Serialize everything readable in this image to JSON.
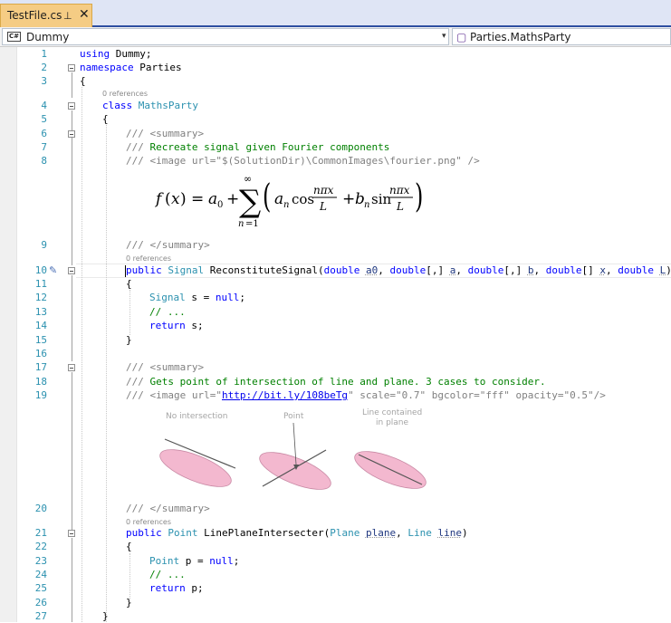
{
  "tab": {
    "title": "TestFile.cs",
    "pin": "⊥",
    "close": "✕"
  },
  "navbar": {
    "left_icon": "C#",
    "left_label": "Dummy",
    "left_arrow": "▾",
    "right_icon": "▢",
    "right_label": "Parties.MathsParty"
  },
  "code": {
    "ln1": "1",
    "ln2": "2",
    "ln3": "3",
    "ln4": "4",
    "ln5": "5",
    "ln6": "6",
    "ln7": "7",
    "ln8": "8",
    "ln9": "9",
    "ln10": "10",
    "ln11": "11",
    "ln12": "12",
    "ln13": "13",
    "ln14": "14",
    "ln15": "15",
    "ln16": "16",
    "ln17": "17",
    "ln18": "18",
    "ln19": "19",
    "ln20": "20",
    "ln21": "21",
    "ln22": "22",
    "ln23": "23",
    "ln24": "24",
    "ln25": "25",
    "ln26": "26",
    "ln27": "27",
    "refs": "0 references",
    "using": "using",
    "dummy": " Dummy;",
    "namespace": "namespace",
    "parties": " Parties",
    "open": "{",
    "close": "}",
    "class": "class",
    "mathsparty": "MathsParty",
    "slashes": "/// ",
    "summary_open": "<summary>",
    "summary_close": "</summary>",
    "recreate": "Recreate signal given Fourier components",
    "image_open": "<image url=",
    "image1_url": "\"$(SolutionDir)\\CommonImages\\fourier.png\"",
    "image1_end": " />",
    "public": "public",
    "signal": "Signal",
    "method1": " ReconstituteSignal(",
    "double": "double",
    "p_a0": "a0",
    "comma": ", ",
    "arr2": "[,] ",
    "arr1": "[] ",
    "p_a": "a",
    "p_b": "b",
    "p_x": "x",
    "p_L": "L",
    "rparen": ")",
    "s_var": " s = ",
    "null": "null",
    "semi": ";",
    "dots": "// ...",
    "return": "return",
    "ret_s": " s;",
    "gets": "Gets point of intersection of line and plane. 3 cases to consider.",
    "image2_link": "http://bit.ly/108beTg",
    "quote": "\"",
    "scale_attr": " scale=",
    "scale_val": "\"0.7\"",
    "bg_attr": " bgcolor=",
    "bg_val": "\"fff\"",
    "op_attr": " opacity=",
    "op_val": "\"0.5\"",
    "image2_end": "/>",
    "point": "Point",
    "method2": " LinePlaneIntersecter(",
    "plane_t": "Plane",
    "p_plane": "plane",
    "line_t": "Line",
    "p_line": "line",
    "p_var": " p = ",
    "ret_p": " p;"
  },
  "illustration": {
    "label1": "No intersection",
    "label2": "Point",
    "label3a": "Line contained",
    "label3b": "in plane",
    "plane_color": "#f3b8cf",
    "line_color": "#555555"
  }
}
